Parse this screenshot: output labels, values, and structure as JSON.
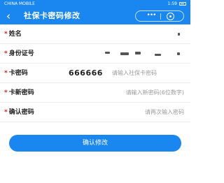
{
  "status_bar": {
    "carrier": "CHINA MOBILE",
    "time": "1:59"
  },
  "nav": {
    "back_icon": "chevron-left-icon",
    "title": "社保卡密码修改",
    "more_icon": "more-dots-icon",
    "close_icon": "circle-close-icon"
  },
  "form": {
    "required_mark": "*",
    "fields": [
      {
        "label": "姓名",
        "value": "",
        "placeholder": ""
      },
      {
        "label": "身份证号",
        "value": "",
        "placeholder": ""
      },
      {
        "label": "卡密码",
        "value": "666666",
        "placeholder": "请输入社保卡密码"
      },
      {
        "label": "卡新密码",
        "value": "",
        "placeholder": "请输入新密码(6位数字)"
      },
      {
        "label": "确认密码",
        "value": "",
        "placeholder": "请再次输入密码"
      }
    ]
  },
  "submit": {
    "label": "确认修改"
  },
  "colors": {
    "primary": "#1a86f0",
    "required": "#e02020"
  }
}
